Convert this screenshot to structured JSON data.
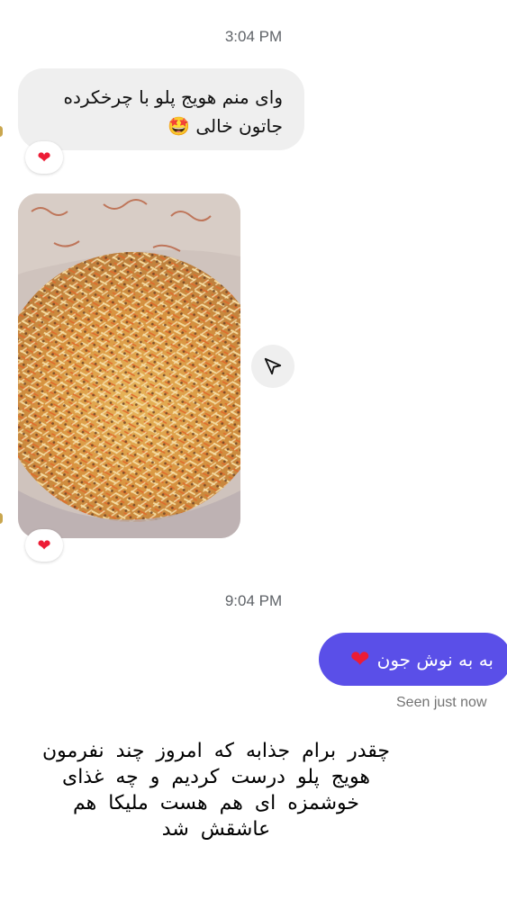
{
  "thread": {
    "time_1": "3:04 PM",
    "incoming_message": "وای منم هویج پلو با چرخکرده جاتون خالی 🤩",
    "reaction_1": "❤",
    "reaction_2": "❤",
    "time_2": "9:04 PM",
    "outgoing_message": "به به نوش جون",
    "outgoing_heart": "❤",
    "seen_status": "Seen just now"
  },
  "overlay_caption": "چقدر برام جذابه که امروز چند نفرمون هویج پلو درست کردیم و چه غذای خوشمزه ای هم هست ملیکا هم عاشقش شد",
  "icons": {
    "share": "paper-plane-icon",
    "reaction": "heart-icon"
  },
  "colors": {
    "outgoing_bubble": "#5a4fe8",
    "incoming_bubble": "#efefef",
    "heart": "#ed1c35"
  }
}
